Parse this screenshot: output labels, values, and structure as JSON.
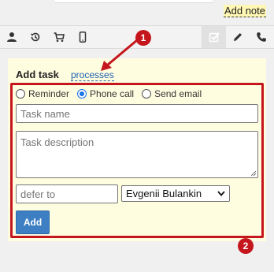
{
  "top": {
    "add_note_label": "Add note"
  },
  "toolbar": {
    "buttons": [
      {
        "icon": "user-icon"
      },
      {
        "icon": "history-icon"
      },
      {
        "icon": "cart-icon"
      },
      {
        "icon": "mobile-icon"
      },
      {
        "icon": "task-check-icon",
        "active": true
      },
      {
        "icon": "pencil-icon"
      },
      {
        "icon": "phone-icon"
      }
    ]
  },
  "task_panel": {
    "title": "Add task",
    "processes_link": "processes",
    "task_types": [
      {
        "label": "Reminder",
        "selected": false
      },
      {
        "label": "Phone call",
        "selected": true
      },
      {
        "label": "Send email",
        "selected": false
      }
    ],
    "task_name_placeholder": "Task name",
    "task_description_placeholder": "Task description",
    "defer_placeholder": "defer to",
    "assignee_selected": "Evgenii Bulankin",
    "add_button_label": "Add"
  },
  "annotations": {
    "marker_1": "1",
    "marker_2": "2",
    "accent_color": "#c4161c"
  }
}
